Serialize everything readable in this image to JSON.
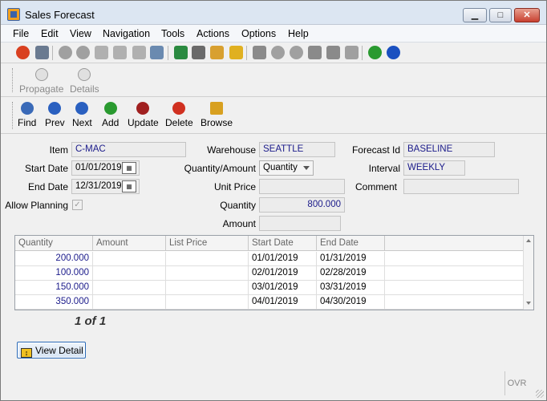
{
  "window": {
    "title": "Sales Forecast"
  },
  "title_buttons": {
    "minimize": "▁",
    "maximize": "□",
    "close": "✕"
  },
  "menu": [
    "File",
    "Edit",
    "View",
    "Navigation",
    "Tools",
    "Actions",
    "Options",
    "Help"
  ],
  "toolbar_icons": [
    {
      "name": "power-icon",
      "color": "#d94020"
    },
    {
      "name": "windows-icon",
      "color": "#6a7a90"
    },
    {
      "name": "check-icon",
      "color": "#a0a0a0"
    },
    {
      "name": "cancel-icon",
      "color": "#a0a0a0"
    },
    {
      "name": "copy-icon",
      "color": "#b0b0b0"
    },
    {
      "name": "paste-icon",
      "color": "#b0b0b0"
    },
    {
      "name": "select-all-icon",
      "color": "#b0b0b0"
    },
    {
      "name": "zoom-icon",
      "color": "#6a8ab0"
    },
    {
      "name": "notepad-icon",
      "color": "#2a8a40"
    },
    {
      "name": "attachment-icon",
      "color": "#6a6a6a"
    },
    {
      "name": "user-notes-icon",
      "color": "#d8a030"
    },
    {
      "name": "calendar-icon",
      "color": "#e0b020"
    },
    {
      "name": "first-record-icon",
      "color": "#8a8a8a"
    },
    {
      "name": "next-down-icon",
      "color": "#a0a0a0"
    },
    {
      "name": "prev-up-icon",
      "color": "#a0a0a0"
    },
    {
      "name": "insert-row-icon",
      "color": "#8a8a8a"
    },
    {
      "name": "delete-row-icon",
      "color": "#8a8a8a"
    },
    {
      "name": "export-icon",
      "color": "#a0a0a0"
    },
    {
      "name": "chart-icon",
      "color": "#2a9a30"
    },
    {
      "name": "help-icon",
      "color": "#1a50c0"
    }
  ],
  "actions": [
    {
      "label": "Propagate",
      "icon": "propagate-icon"
    },
    {
      "label": "Details",
      "icon": "details-icon"
    }
  ],
  "nav": [
    {
      "label": "Find",
      "icon": "find-icon",
      "color": "#3a6ab8"
    },
    {
      "label": "Prev",
      "icon": "prev-icon",
      "color": "#2a60c0"
    },
    {
      "label": "Next",
      "icon": "next-icon",
      "color": "#2a60c0"
    },
    {
      "label": "Add",
      "icon": "add-icon",
      "color": "#2a9a30"
    },
    {
      "label": "Update",
      "icon": "update-icon",
      "color": "#a02020"
    },
    {
      "label": "Delete",
      "icon": "delete-icon",
      "color": "#d03020"
    },
    {
      "label": "Browse",
      "icon": "browse-icon",
      "color": "#d8a020"
    }
  ],
  "form": {
    "item_label": "Item",
    "item_value": "C-MAC",
    "warehouse_label": "Warehouse",
    "warehouse_value": "SEATTLE",
    "forecast_id_label": "Forecast Id",
    "forecast_id_value": "BASELINE",
    "start_date_label": "Start Date",
    "start_date_value": "01/01/2019",
    "qty_amount_label": "Quantity/Amount",
    "qty_amount_value": "Quantity",
    "interval_label": "Interval",
    "interval_value": "WEEKLY",
    "end_date_label": "End Date",
    "end_date_value": "12/31/2019",
    "unit_price_label": "Unit Price",
    "unit_price_value": "",
    "comment_label": "Comment",
    "comment_value": "",
    "allow_planning_label": "Allow Planning",
    "allow_planning_checked": "✓",
    "quantity_label": "Quantity",
    "quantity_value": "800.000",
    "amount_label": "Amount",
    "amount_value": ""
  },
  "grid": {
    "columns": [
      "Quantity",
      "Amount",
      "List Price",
      "Start Date",
      "End Date"
    ],
    "rows": [
      {
        "quantity": "200.000",
        "amount": "",
        "list_price": "",
        "start_date": "01/01/2019",
        "end_date": "01/31/2019"
      },
      {
        "quantity": "100.000",
        "amount": "",
        "list_price": "",
        "start_date": "02/01/2019",
        "end_date": "02/28/2019"
      },
      {
        "quantity": "150.000",
        "amount": "",
        "list_price": "",
        "start_date": "03/01/2019",
        "end_date": "03/31/2019"
      },
      {
        "quantity": "350.000",
        "amount": "",
        "list_price": "",
        "start_date": "04/01/2019",
        "end_date": "04/30/2019"
      }
    ]
  },
  "pager": "1 of 1",
  "view_detail_label": "View Detail",
  "status": {
    "ovr": "OVR"
  }
}
